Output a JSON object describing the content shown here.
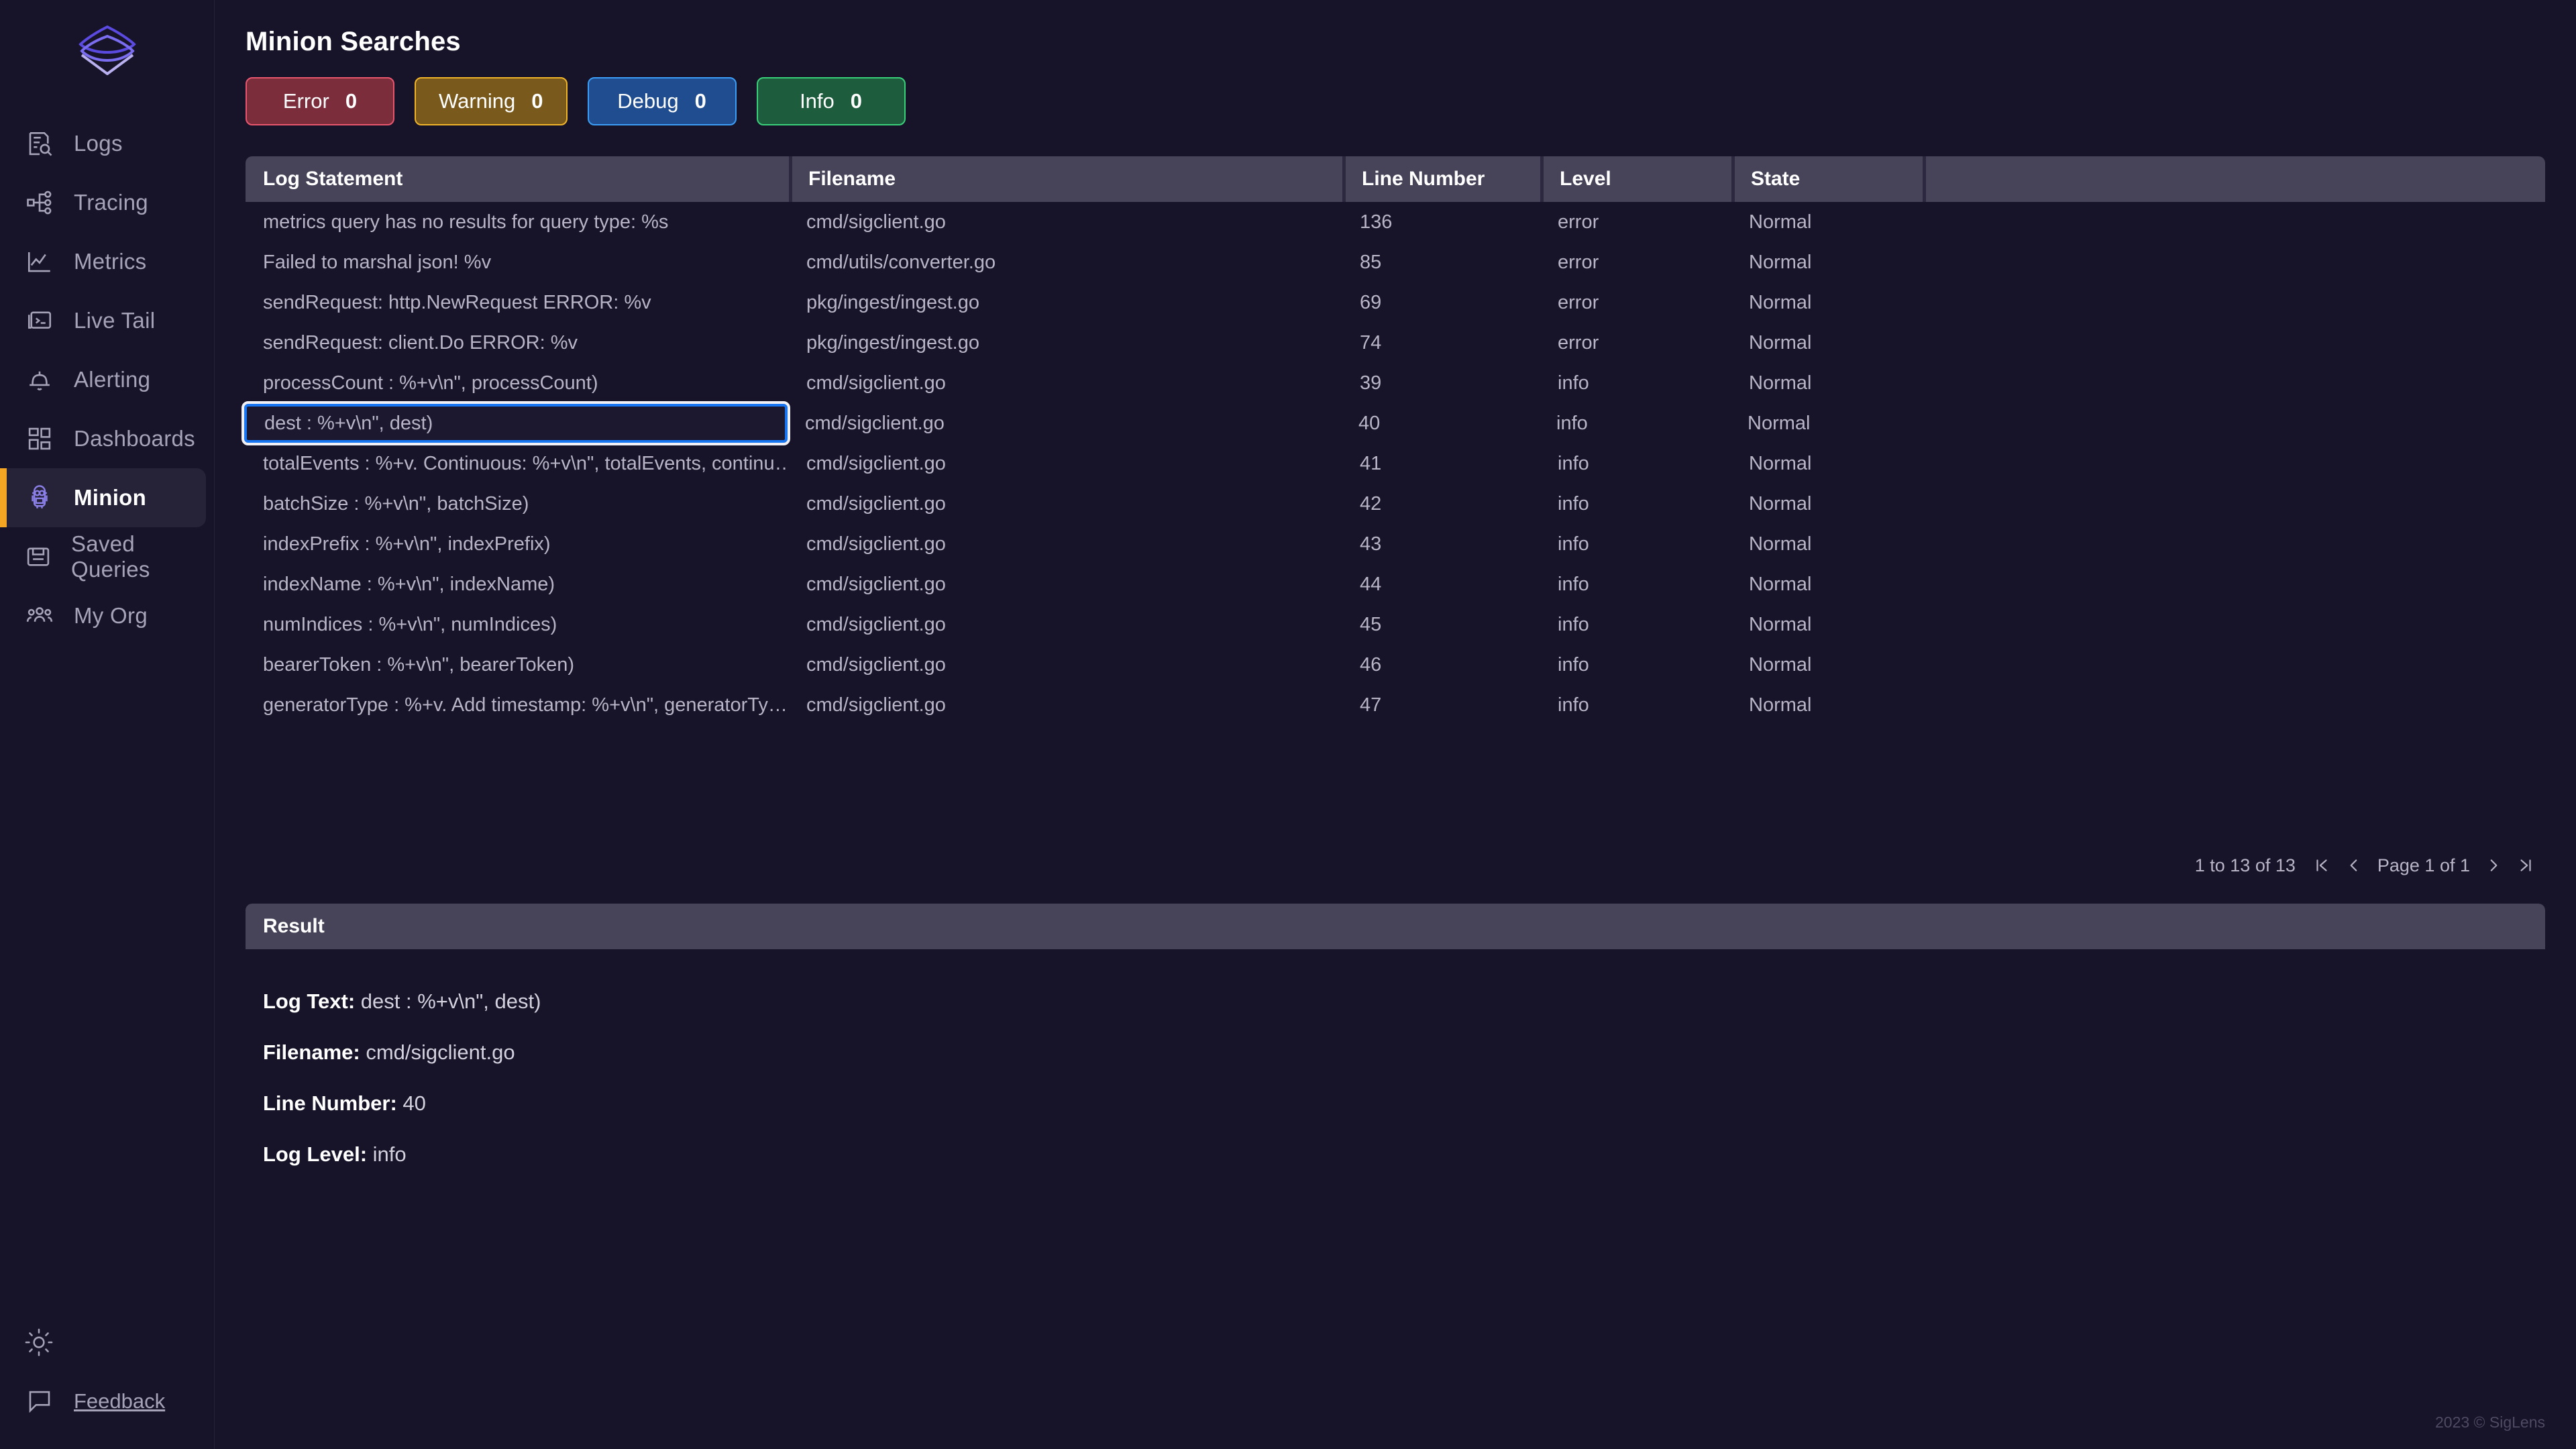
{
  "sidebar": {
    "logo_name": "siglens-logo",
    "items": [
      {
        "label": "Logs",
        "icon": "logs-search-icon",
        "active": false
      },
      {
        "label": "Tracing",
        "icon": "tracing-node-icon",
        "active": false
      },
      {
        "label": "Metrics",
        "icon": "metrics-line-chart-icon",
        "active": false
      },
      {
        "label": "Live Tail",
        "icon": "terminal-window-icon",
        "active": false
      },
      {
        "label": "Alerting",
        "icon": "bell-icon",
        "active": false
      },
      {
        "label": "Dashboards",
        "icon": "grid-squares-icon",
        "active": false
      },
      {
        "label": "Minion",
        "icon": "minion-icon",
        "active": true
      },
      {
        "label": "Saved Queries",
        "icon": "floppy-save-icon",
        "active": false
      },
      {
        "label": "My Org",
        "icon": "people-group-icon",
        "active": false
      }
    ],
    "theme_toggle_icon": "sun-icon",
    "feedback_label": "Feedback",
    "feedback_icon": "speech-bubble-icon"
  },
  "header": {
    "title": "Minion Searches"
  },
  "filters": [
    {
      "label": "Error",
      "count": "0",
      "bg": "#7c2d3c",
      "border": "#e8566e"
    },
    {
      "label": "Warning",
      "count": "0",
      "bg": "#7a5a1c",
      "border": "#f0b429"
    },
    {
      "label": "Debug",
      "count": "0",
      "bg": "#1f4d8f",
      "border": "#3b9df5"
    },
    {
      "label": "Info",
      "count": "0",
      "bg": "#1d5c3c",
      "border": "#3ad07a"
    }
  ],
  "table": {
    "columns": [
      "Log Statement",
      "Filename",
      "Line Number",
      "Level",
      "State"
    ],
    "selected_row_index": 5,
    "rows": [
      {
        "log": "metrics query has no results for query type: %s",
        "file": "cmd/sigclient.go",
        "line": "136",
        "level": "error",
        "state": "Normal"
      },
      {
        "log": "Failed to marshal json! %v",
        "file": "cmd/utils/converter.go",
        "line": "85",
        "level": "error",
        "state": "Normal"
      },
      {
        "log": "sendRequest: http.NewRequest ERROR: %v",
        "file": "pkg/ingest/ingest.go",
        "line": "69",
        "level": "error",
        "state": "Normal"
      },
      {
        "log": "sendRequest: client.Do ERROR: %v",
        "file": "pkg/ingest/ingest.go",
        "line": "74",
        "level": "error",
        "state": "Normal"
      },
      {
        "log": "processCount : %+v\\n\", processCount)",
        "file": "cmd/sigclient.go",
        "line": "39",
        "level": "info",
        "state": "Normal"
      },
      {
        "log": "dest : %+v\\n\", dest)",
        "file": "cmd/sigclient.go",
        "line": "40",
        "level": "info",
        "state": "Normal"
      },
      {
        "log": "totalEvents : %+v. Continuous: %+v\\n\", totalEvents, continu…",
        "file": "cmd/sigclient.go",
        "line": "41",
        "level": "info",
        "state": "Normal"
      },
      {
        "log": "batchSize : %+v\\n\", batchSize)",
        "file": "cmd/sigclient.go",
        "line": "42",
        "level": "info",
        "state": "Normal"
      },
      {
        "log": "indexPrefix : %+v\\n\", indexPrefix)",
        "file": "cmd/sigclient.go",
        "line": "43",
        "level": "info",
        "state": "Normal"
      },
      {
        "log": "indexName : %+v\\n\", indexName)",
        "file": "cmd/sigclient.go",
        "line": "44",
        "level": "info",
        "state": "Normal"
      },
      {
        "log": "numIndices : %+v\\n\", numIndices)",
        "file": "cmd/sigclient.go",
        "line": "45",
        "level": "info",
        "state": "Normal"
      },
      {
        "log": "bearerToken : %+v\\n\", bearerToken)",
        "file": "cmd/sigclient.go",
        "line": "46",
        "level": "info",
        "state": "Normal"
      },
      {
        "log": "generatorType : %+v. Add timestamp: %+v\\n\", generatorTy…",
        "file": "cmd/sigclient.go",
        "line": "47",
        "level": "info",
        "state": "Normal"
      }
    ],
    "pagination": {
      "range_text": "1 to 13 of 13",
      "page_text": "Page 1 of 1",
      "first_icon": "first-page-icon",
      "prev_icon": "previous-page-icon",
      "next_icon": "next-page-icon",
      "last_icon": "last-page-icon"
    }
  },
  "result": {
    "title": "Result",
    "fields": [
      {
        "label": "Log Text:",
        "value": "dest : %+v\\n\", dest)"
      },
      {
        "label": "Filename:",
        "value": "cmd/sigclient.go"
      },
      {
        "label": "Line Number:",
        "value": "40"
      },
      {
        "label": "Log Level:",
        "value": "info"
      }
    ]
  },
  "footer": {
    "copyright": "2023 © SigLens"
  }
}
